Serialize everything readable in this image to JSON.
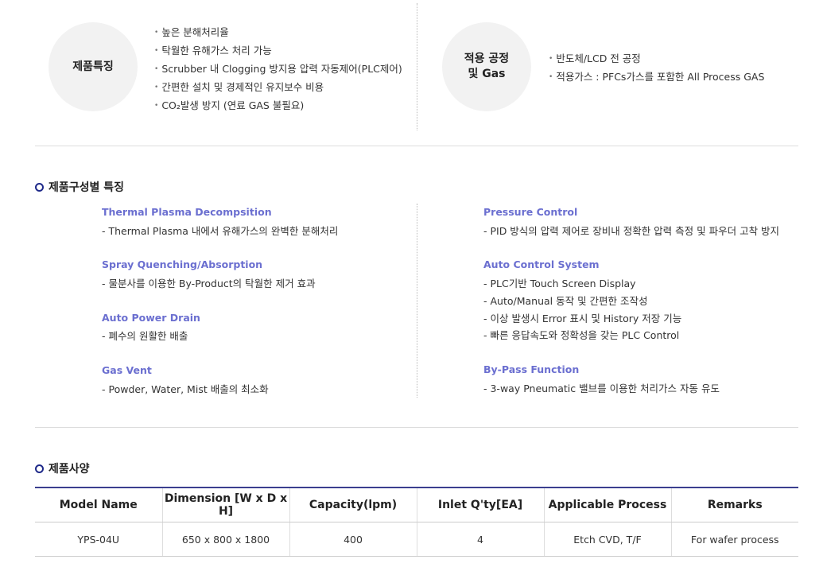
{
  "top": {
    "features_label": "제품특징",
    "features": [
      "높은 분해처리율",
      "탁월한 유해가스 처리 가능",
      "Scrubber 내 Clogging 방지용 압력 자동제어(PLC제어)",
      "간편한 설치 및 경제적인 유지보수 비용",
      "CO₂발생 방지 (연료 GAS 불필요)"
    ],
    "process_label_line1": "적용 공정",
    "process_label_line2": "및 Gas",
    "process": [
      "반도체/LCD 전 공정",
      "적용가스 : PFCs가스를 포함한 All Process GAS"
    ]
  },
  "components": {
    "title": "제품구성별 특징",
    "left": [
      {
        "title": "Thermal Plasma Decompsition",
        "desc": [
          "- Thermal Plasma 내에서 유해가스의 완벽한 분해처리"
        ]
      },
      {
        "title": "Spray Quenching/Absorption",
        "desc": [
          "- 물분사를 이용한 By-Product의 탁월한 제거 효과"
        ]
      },
      {
        "title": "Auto Power Drain",
        "desc": [
          "- 폐수의 원활한 배출"
        ]
      },
      {
        "title": "Gas Vent",
        "desc": [
          "- Powder, Water, Mist 배출의 최소화"
        ]
      }
    ],
    "right": [
      {
        "title": "Pressure Control",
        "desc": [
          "- PID 방식의 압력 제어로 장비내 정확한 압력 측정 및 파우더 고착 방지"
        ]
      },
      {
        "title": "Auto Control System",
        "desc": [
          "- PLC기반 Touch Screen Display",
          "- Auto/Manual 동작 및 간편한 조작성",
          "- 이상 발생시 Error 표시 및 History 저장 기능",
          "- 빠른 응답속도와 정확성을 갖는 PLC Control"
        ]
      },
      {
        "title": "By-Pass Function",
        "desc": [
          "- 3-way Pneumatic 밸브를 이용한 처리가스 자동 유도"
        ]
      }
    ]
  },
  "spec": {
    "title": "제품사양",
    "headers": [
      "Model Name",
      "Dimension [W x D x H]",
      "Capacity(lpm)",
      "Inlet Q'ty[EA]",
      "Applicable Process",
      "Remarks"
    ],
    "rows": [
      [
        "YPS-04U",
        "650 x 800 x 1800",
        "400",
        "4",
        "Etch CVD, T/F",
        "For wafer process"
      ]
    ]
  },
  "colors": {
    "accent": "#1f2a8a",
    "component_title": "#6b6fd0",
    "table_border": "#3b3f8f"
  }
}
